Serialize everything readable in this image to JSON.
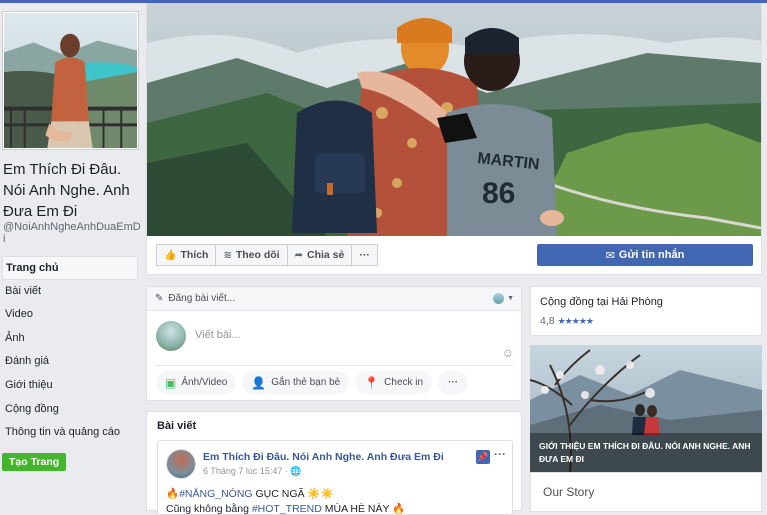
{
  "page": {
    "name": "Em Thích Đi Đâu. Nói Anh Nghe. Anh Đưa Em Đi",
    "handle": "@NoiAnhNgheAnhDuaEmDi"
  },
  "nav": {
    "items": [
      "Trang chủ",
      "Bài viết",
      "Video",
      "Ảnh",
      "Đánh giá",
      "Giới thiệu",
      "Cộng đồng",
      "Thông tin và quảng cáo"
    ],
    "create_button": "Tạo Trang"
  },
  "actions": {
    "like": "Thích",
    "follow": "Theo dõi",
    "share": "Chia sẻ",
    "more": "···",
    "send_message": "Gửi tin nhắn"
  },
  "composer": {
    "header": "Đăng bài viết...",
    "placeholder": "Viết bài...",
    "buttons": {
      "photo": "Ảnh/Video",
      "tag": "Gắn thẻ bạn bè",
      "checkin": "Check in",
      "more": "···"
    }
  },
  "posts": {
    "title": "Bài viết",
    "post": {
      "author": "Em Thích Đi Đâu. Nói Anh Nghe. Anh Đưa Em Đi",
      "time": "6 Tháng 7 lúc 15:47 · ",
      "line1_fire": "🔥",
      "line1_hashtag": "#NẮNG_NÓNG",
      "line1_text": " GỤC NGÃ ☀️☀️",
      "line2_text": "Cũng không bằng ",
      "line2_hashtag": "#HOT_TREND",
      "line2_rest": " MÙA HÈ NÀY 🔥"
    }
  },
  "sidebar_right": {
    "community_title": "Cộng đồng tại Hải Phòng",
    "rating": "4,8",
    "stars": "★★★★★",
    "promo_text": "GIỚI THIỆU EM THÍCH ĐI ĐÂU. NÓI ANH NGHE. ANH ĐƯA EM ĐI",
    "story_title": "Our Story"
  },
  "colors": {
    "brand": "#4267b2",
    "create": "#42b72a",
    "link": "#385898"
  },
  "icons": {
    "like": "thumbs-up-icon",
    "follow": "rss-icon",
    "share": "share-arrow-icon",
    "messenger": "messenger-icon",
    "pen": "pencil-icon",
    "photo": "photo-icon",
    "tag": "tag-friend-icon",
    "checkin": "location-pin-icon",
    "pin": "pin-icon",
    "emoji": "smiley-icon"
  }
}
